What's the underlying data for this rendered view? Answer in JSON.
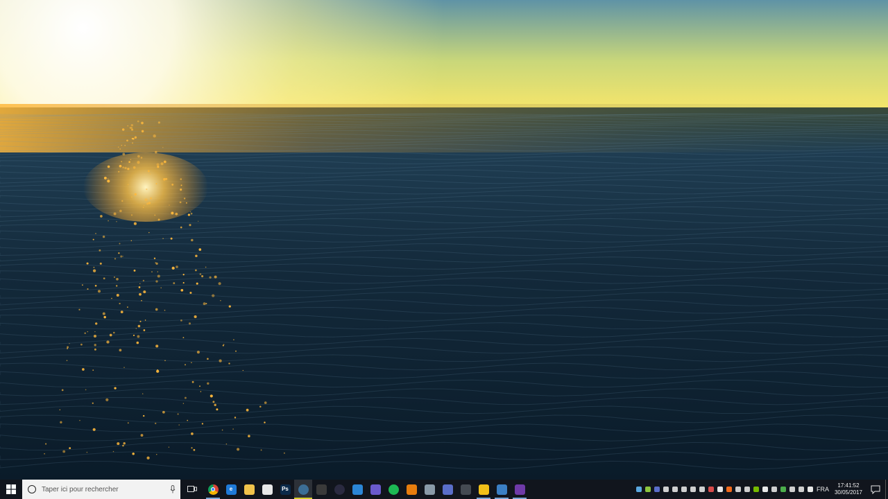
{
  "wallpaper": {
    "name": "ocean-sunset",
    "sky_top": "#5f93a6",
    "sky_horizon": "#f7e66a",
    "sun": "#fff7d8",
    "water_far": "#1d3f55",
    "water_near": "#0a1b29",
    "glint": "#ffb93c"
  },
  "taskbar": {
    "accent": "#d8cf2a",
    "start_icon": "windows-logo-icon",
    "search": {
      "placeholder": "Taper ici pour rechercher",
      "icon": "cortana-ring-icon",
      "mic_icon": "microphone-icon"
    },
    "task_view_icon": "task-view-icon",
    "apps": [
      {
        "name": "chrome",
        "icon": "chrome-icon",
        "label": "",
        "bg": "#dd4b39",
        "open": true,
        "active": false
      },
      {
        "name": "edge",
        "icon": "edge-icon",
        "label": "e",
        "bg": "#1f7ad8",
        "open": false,
        "active": false
      },
      {
        "name": "file-explorer",
        "icon": "folder-icon",
        "label": "",
        "bg": "#f2c34b",
        "open": false,
        "active": false
      },
      {
        "name": "store",
        "icon": "store-bag-icon",
        "label": "",
        "bg": "#e8e8e8",
        "open": false,
        "active": false
      },
      {
        "name": "photoshop",
        "icon": "photoshop-icon",
        "label": "Ps",
        "bg": "#0b2a4a",
        "open": false,
        "active": false
      },
      {
        "name": "steam",
        "icon": "steam-icon",
        "label": "",
        "bg": "#3c6e96",
        "open": true,
        "active": true
      },
      {
        "name": "media-app",
        "icon": "speaker-icon",
        "label": "",
        "bg": "#3a3a3a",
        "open": false,
        "active": false
      },
      {
        "name": "obs",
        "icon": "obs-icon",
        "label": "",
        "bg": "#2a2a40",
        "open": false,
        "active": false
      },
      {
        "name": "visual-studio-code",
        "icon": "vs-code-icon",
        "label": "",
        "bg": "#2b86d6",
        "open": false,
        "active": false
      },
      {
        "name": "media-player",
        "icon": "media-player-icon",
        "label": "",
        "bg": "#6a5acd",
        "open": false,
        "active": false
      },
      {
        "name": "spotify",
        "icon": "spotify-icon",
        "label": "",
        "bg": "#1db954",
        "open": false,
        "active": false
      },
      {
        "name": "blender",
        "icon": "blender-icon",
        "label": "",
        "bg": "#e87d0d",
        "open": false,
        "active": false
      },
      {
        "name": "remote-desktop",
        "icon": "monitor-icon",
        "label": "",
        "bg": "#8a9aa8",
        "open": false,
        "active": false
      },
      {
        "name": "discord",
        "icon": "discord-icon",
        "label": "",
        "bg": "#5a6ec9",
        "open": false,
        "active": false
      },
      {
        "name": "speedometer",
        "icon": "gauge-icon",
        "label": "",
        "bg": "#444a52",
        "open": false,
        "active": false
      },
      {
        "name": "unknown-yellow-app",
        "icon": "puzzle-icon",
        "label": "",
        "bg": "#f2c018",
        "open": true,
        "active": false
      },
      {
        "name": "unknown-blue-app",
        "icon": "grid-app-icon",
        "label": "",
        "bg": "#3b7fc4",
        "open": true,
        "active": false
      },
      {
        "name": "visual-studio",
        "icon": "visual-studio-icon",
        "label": "",
        "bg": "#6f3aa8",
        "open": true,
        "active": false
      }
    ],
    "tray": {
      "icons": [
        {
          "name": "tray-gpu-icon",
          "color": "#5aa8e0"
        },
        {
          "name": "tray-leaf-icon",
          "color": "#8cc63f"
        },
        {
          "name": "tray-chat-icon",
          "color": "#5a6ec9"
        },
        {
          "name": "tray-pen-icon",
          "color": "#cfcfcf"
        },
        {
          "name": "tray-text-icon",
          "color": "#cfcfcf"
        },
        {
          "name": "tray-network-icon",
          "color": "#cfcfcf"
        },
        {
          "name": "tray-shield-icon",
          "color": "#cfcfcf"
        },
        {
          "name": "tray-game-icon",
          "color": "#cfcfcf"
        },
        {
          "name": "tray-paint-icon",
          "color": "#d84b4b"
        },
        {
          "name": "tray-record-icon",
          "color": "#e8e8e8"
        },
        {
          "name": "tray-origin-icon",
          "color": "#f26a1b"
        },
        {
          "name": "tray-circle-icon",
          "color": "#cfcfcf"
        },
        {
          "name": "tray-cloud-icon",
          "color": "#cfcfcf"
        },
        {
          "name": "tray-nvidia-icon",
          "color": "#76b900"
        },
        {
          "name": "tray-dropbox-icon",
          "color": "#e8e8e8"
        },
        {
          "name": "tray-usb-icon",
          "color": "#cfcfcf"
        },
        {
          "name": "tray-drive-icon",
          "color": "#4cae4c"
        },
        {
          "name": "tray-steam-icon",
          "color": "#cfcfcf"
        },
        {
          "name": "tray-monitor-icon",
          "color": "#cfcfcf"
        },
        {
          "name": "tray-volume-icon",
          "color": "#e8e8e8"
        }
      ],
      "language": "FRA",
      "time": "17:41:52",
      "date": "30/05/2017",
      "notification_icon": "action-center-icon"
    }
  }
}
